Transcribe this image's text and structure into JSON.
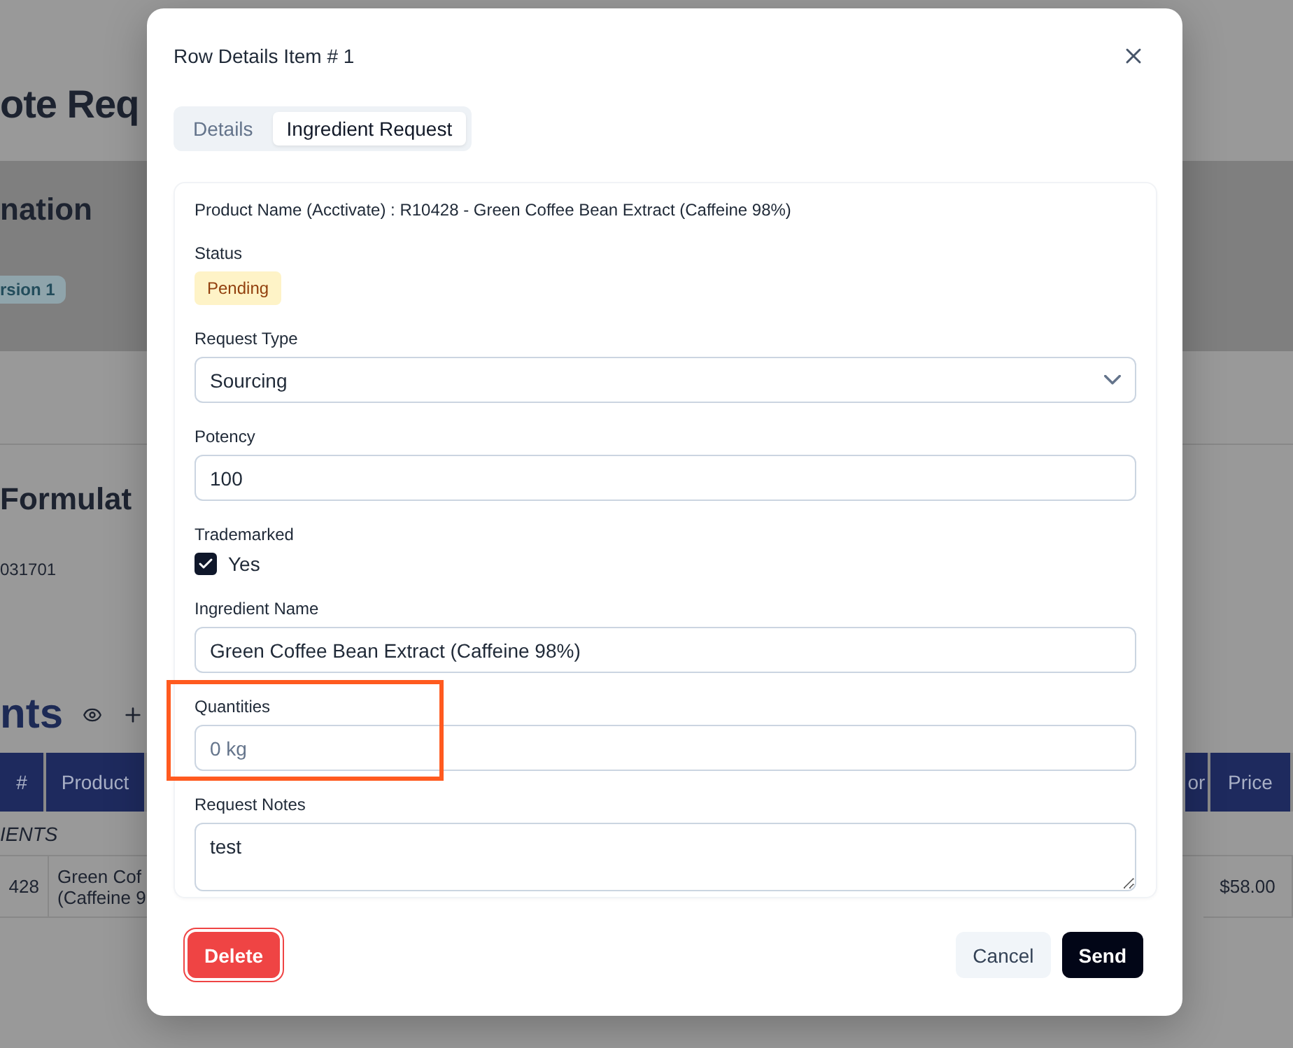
{
  "background": {
    "page_title": "ote Req",
    "section_heading": "nation",
    "version_badge": "rsion 1",
    "formulation_heading": "Formulat",
    "formulation_code": "031701",
    "ingredients_heading": "nts",
    "table": {
      "left_columns": [
        {
          "label": "#"
        },
        {
          "label": "Product"
        }
      ],
      "right_columns": [
        {
          "label": "or"
        },
        {
          "label": "Price"
        }
      ],
      "group_label": "IENTS",
      "rows": [
        {
          "number": "428",
          "product": [
            "Green Cof",
            "(Caffeine 9"
          ],
          "price": "$58.00"
        }
      ]
    }
  },
  "dialog": {
    "title": "Row Details Item # 1",
    "tabs": [
      {
        "label": "Details",
        "selected": false
      },
      {
        "label": "Ingredient Request",
        "selected": true
      }
    ],
    "product_line": "Product Name (Acctivate) : R10428 - Green Coffee Bean Extract (Caffeine 98%)",
    "status": {
      "label": "Status",
      "badge": "Pending"
    },
    "fields": [
      {
        "kind": "select",
        "label": "Request Type",
        "value": "Sourcing",
        "highlighted": false
      },
      {
        "kind": "text",
        "label": "Potency",
        "value": "100",
        "highlighted": false
      },
      {
        "kind": "checkbox",
        "label": "Trademarked",
        "option": "Yes",
        "checked": true,
        "highlighted": false
      },
      {
        "kind": "text",
        "label": "Ingredient Name",
        "value": "Green Coffee Bean Extract (Caffeine 98%)",
        "highlighted": false
      },
      {
        "kind": "text",
        "label": "Quantities",
        "placeholder": "0 kg",
        "highlighted": true
      },
      {
        "kind": "textarea",
        "label": "Request Notes",
        "value": "test",
        "highlighted": false
      }
    ],
    "buttons": [
      {
        "kind": "danger",
        "label": "Delete"
      },
      {
        "kind": "secondary",
        "label": "Cancel"
      },
      {
        "kind": "primary",
        "label": "Send"
      }
    ]
  }
}
